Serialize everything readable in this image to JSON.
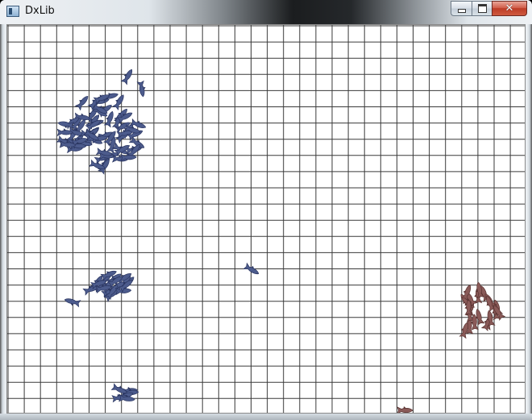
{
  "window": {
    "title": "DxLib",
    "icon": "app-window-icon",
    "controls": {
      "minimize": "minimize-icon",
      "maximize": "maximize-icon",
      "close": "close-icon"
    }
  },
  "colors": {
    "grid_line": "#3a3a3a",
    "canvas_bg": "#ffffff",
    "fish_blue": "#4c5b8c",
    "fish_blue_dark": "#2a3560",
    "fish_red": "#8a5a58",
    "fish_red_dark": "#5a3432"
  }
}
